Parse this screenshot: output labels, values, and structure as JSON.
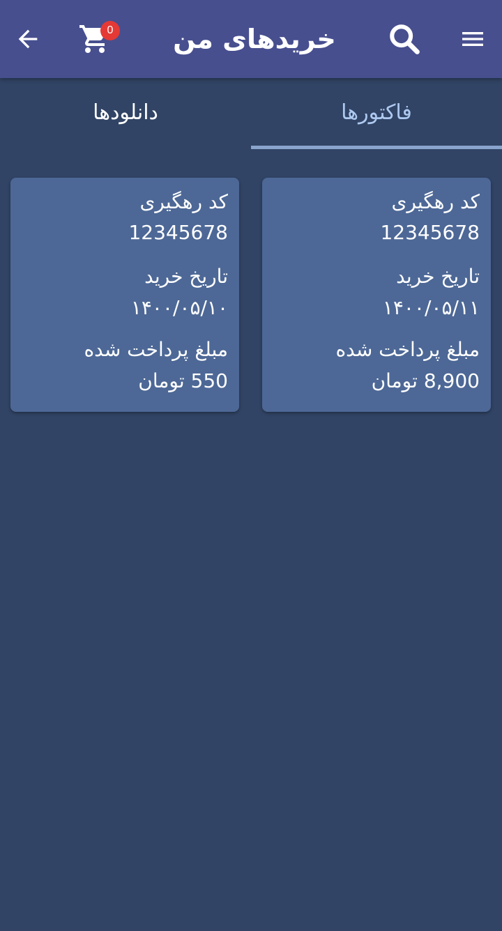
{
  "header": {
    "title": "خریدهای من",
    "cart_count": "0",
    "icons": {
      "back": "arrow-left-icon",
      "cart": "cart-icon",
      "search": "search-icon",
      "menu": "hamburger-menu-icon"
    },
    "background": "#474f8f"
  },
  "tabs": [
    {
      "label": "فاکتورها",
      "selected": true
    },
    {
      "label": "دانلودها",
      "selected": false
    }
  ],
  "invoices": [
    {
      "tracking_label": "کد رهگیری",
      "tracking_code": "12345678",
      "date_label": "تاریخ خرید",
      "date": "۱۴۰۰/۰۵/۱۱",
      "amount_label": "مبلغ پرداخت شده",
      "amount": "8,900",
      "currency": "تومان"
    },
    {
      "tracking_label": "کد رهگیری",
      "tracking_code": "12345678",
      "date_label": "تاریخ خرید",
      "date": "۱۴۰۰/۰۵/۱۰",
      "amount_label": "مبلغ پرداخت شده",
      "amount": "550",
      "currency": "تومان"
    }
  ],
  "colors": {
    "page_background": "#314465",
    "card_background": "#4d6896",
    "badge": "#e53935",
    "selected_tab_text": "#aec9f0"
  }
}
